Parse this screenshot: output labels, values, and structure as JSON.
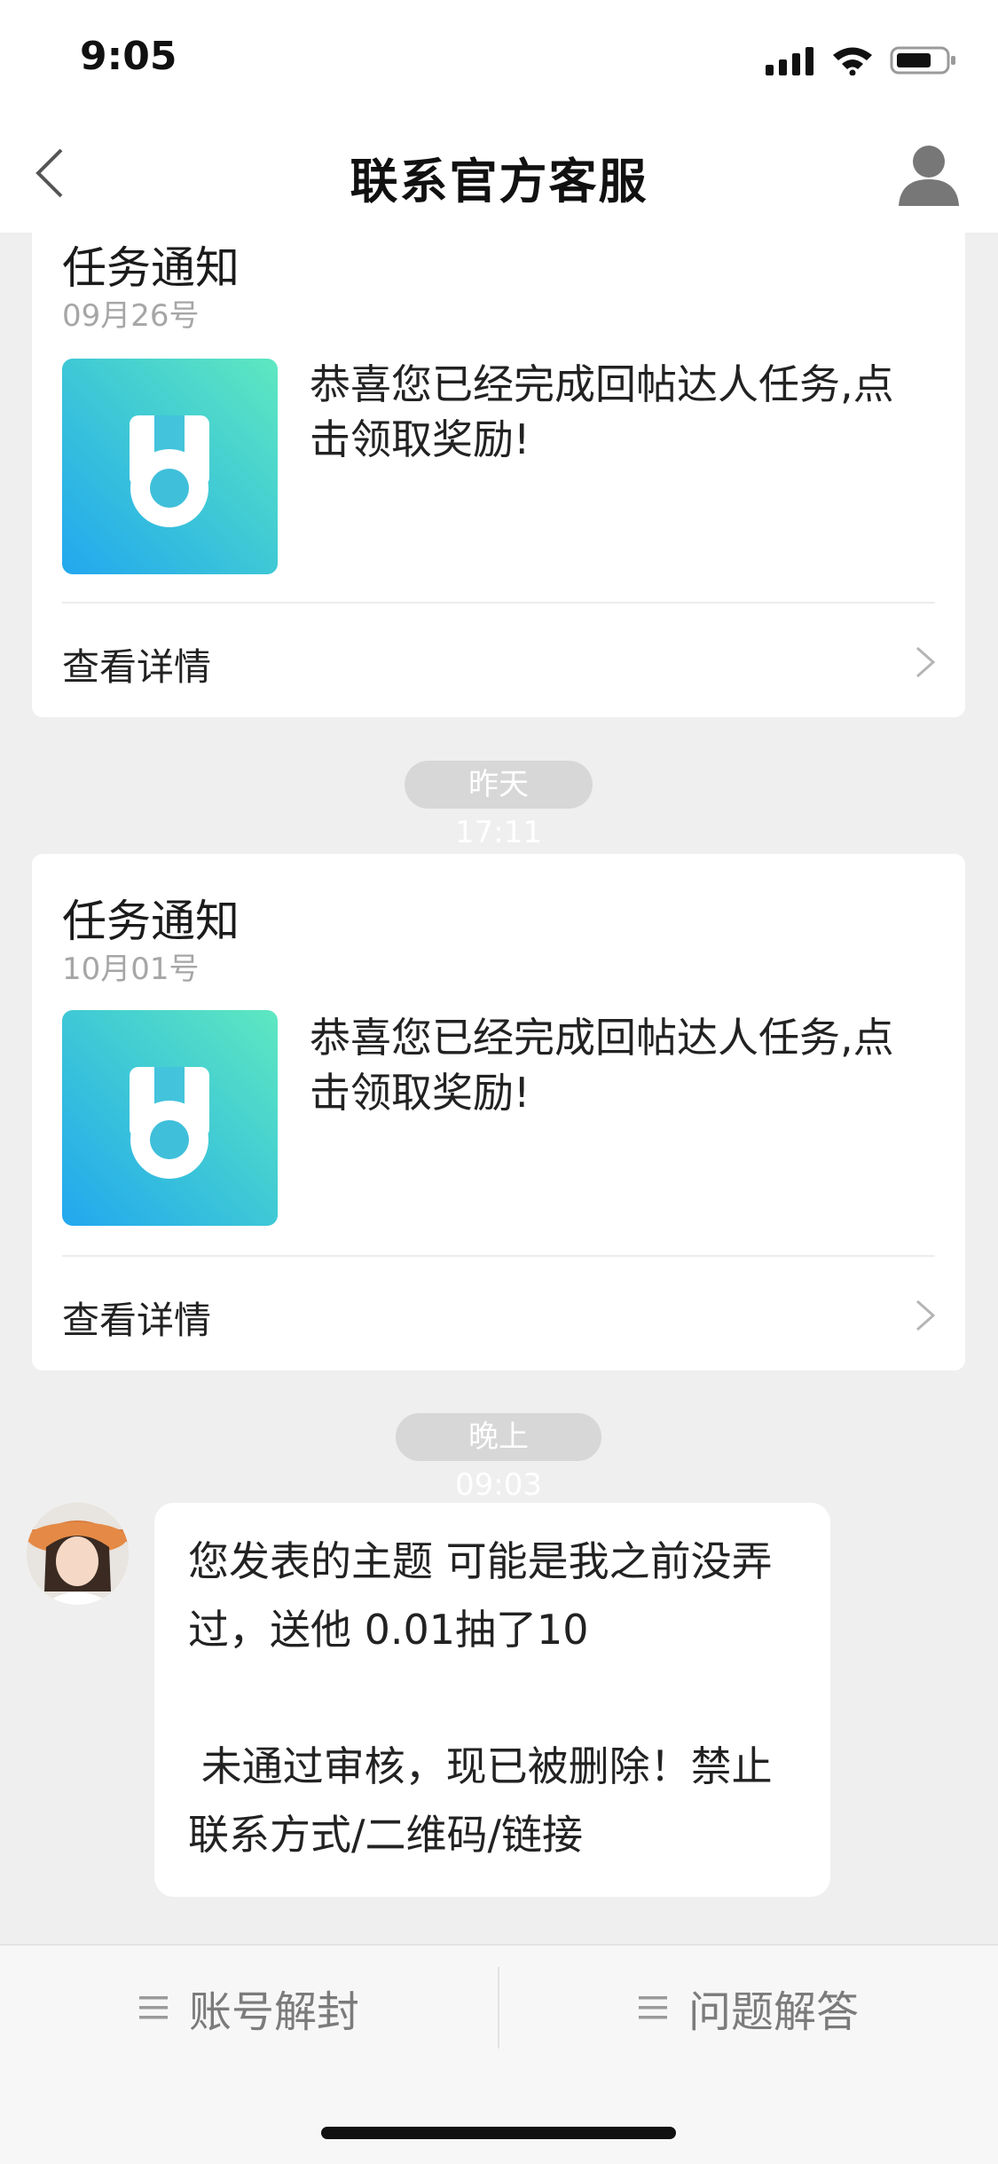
{
  "status_bar": {
    "time": "9:05"
  },
  "nav": {
    "title": "联系官方客服"
  },
  "cards": [
    {
      "title": "任务通知",
      "date": "09月26号",
      "message": "恭喜您已经完成回帖达人任务,点击领取奖励!",
      "link_label": "查看详情"
    },
    {
      "title": "任务通知",
      "date": "10月01号",
      "message": "恭喜您已经完成回帖达人任务,点击领取奖励!",
      "link_label": "查看详情"
    }
  ],
  "timestamps": {
    "first": "昨天 17:11",
    "second": "晚上 09:03"
  },
  "chat_message": {
    "text": "您发表的主题 可能是我之前没弄过，送他 0.01抽了10\n\n 未通过审核，现已被删除！禁止联系方式/二维码/链接"
  },
  "bottom_menu": {
    "left_label": "账号解封",
    "right_label": "问题解答"
  },
  "icons": {
    "back": "chevron-left-icon",
    "profile": "person-icon",
    "card_thumb": "medal-icon",
    "menu": "hamburger-icon"
  },
  "colors": {
    "thumb_gradient_start": "#22a7ef",
    "thumb_gradient_end": "#5ee8c0",
    "background": "#efefef"
  }
}
